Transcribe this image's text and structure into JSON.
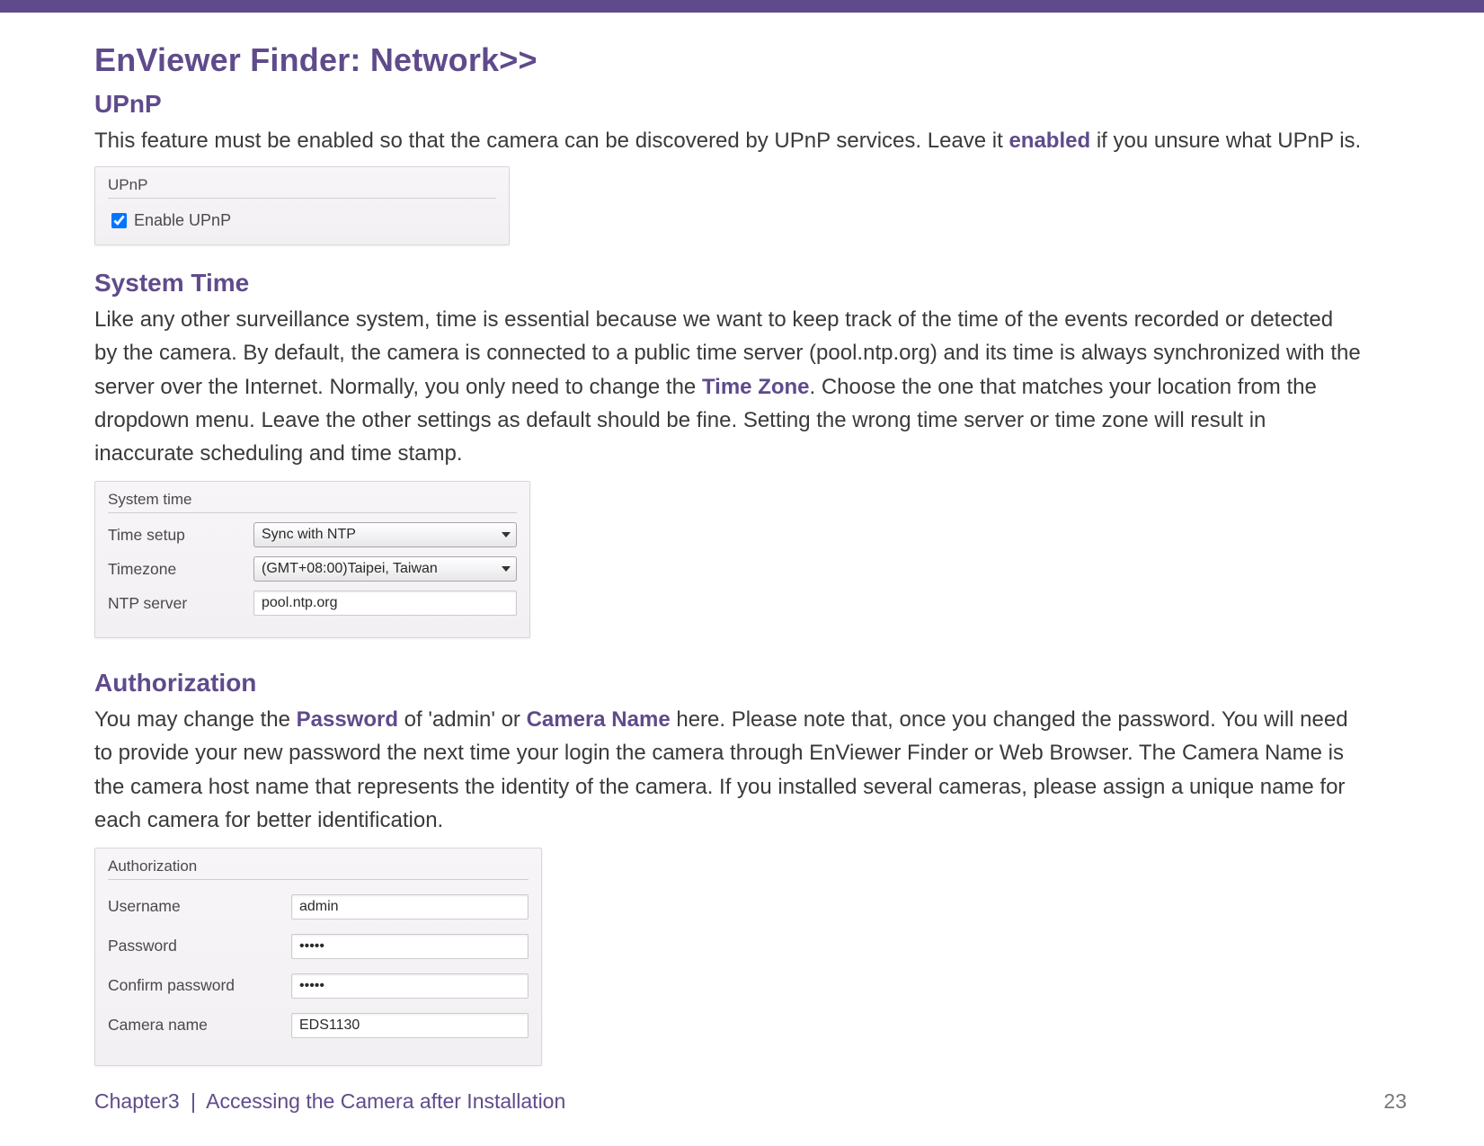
{
  "title": "EnViewer Finder: Network>>",
  "sections": {
    "upnp": {
      "heading": "UPnP",
      "body_parts": [
        "This feature must be enabled so that the camera can be discovered by UPnP services. Leave it ",
        "enabled",
        " if you unsure what UPnP is."
      ],
      "panel_legend": "UPnP",
      "checkbox_label": "Enable UPnP",
      "checkbox_checked": true
    },
    "systime": {
      "heading": "System Time",
      "body_parts": [
        "Like any other surveillance system, time is essential because we want to keep track of the time of the events recorded or detected by the camera. By default, the camera is connected to a public time server (pool.ntp.org) and its time is always synchronized with the server over the Internet. Normally, you only need to change the ",
        "Time Zone",
        ". Choose the one that matches your location from the dropdown menu. Leave the other settings as default should be fine. Setting the wrong time server or time zone will result in inaccurate scheduling and time stamp."
      ],
      "panel_legend": "System time",
      "rows": {
        "time_setup": {
          "label": "Time setup",
          "value": "Sync with NTP"
        },
        "timezone": {
          "label": "Timezone",
          "value": "(GMT+08:00)Taipei, Taiwan"
        },
        "ntp_server": {
          "label": "NTP server",
          "value": "pool.ntp.org"
        }
      }
    },
    "auth": {
      "heading": "Authorization",
      "body_parts": [
        "You may change the ",
        "Password",
        " of 'admin' or ",
        "Camera Name",
        " here. Please note that, once you changed the password. You will need to provide your new password the next time your login the camera through EnViewer Finder or Web Browser. The Camera Name is the camera host name that represents the identity of the camera. If you installed several cameras, please assign a unique name for each camera for better identification."
      ],
      "panel_legend": "Authorization",
      "rows": {
        "username": {
          "label": "Username",
          "value": "admin"
        },
        "password": {
          "label": "Password",
          "value": "•••••"
        },
        "confirm_password": {
          "label": "Confirm password",
          "value": "•••••"
        },
        "camera_name": {
          "label": "Camera name",
          "value": "EDS1130"
        }
      }
    }
  },
  "footer": {
    "chapter": "Chapter3",
    "divider": "|",
    "title": "Accessing the Camera after Installation",
    "page_number": "23"
  }
}
